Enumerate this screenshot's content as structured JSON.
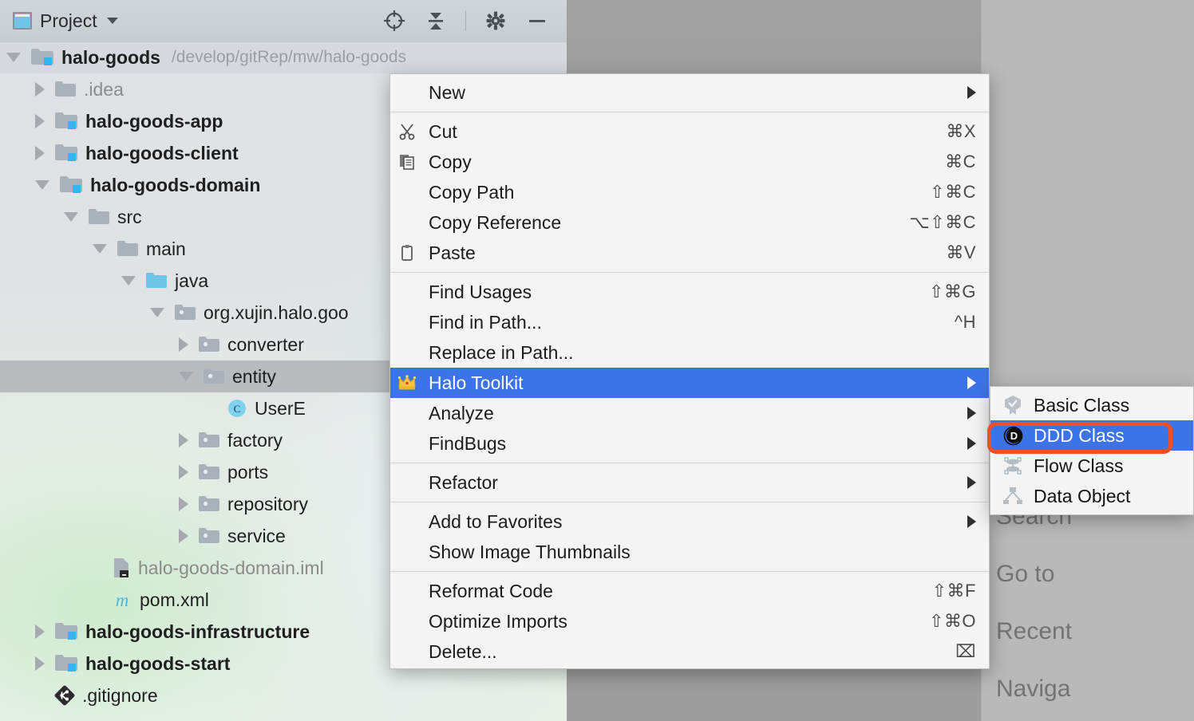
{
  "toolwindow": {
    "title": "Project",
    "icon": "project-icon",
    "caret": "chevron-down-icon",
    "actions": [
      {
        "name": "select-opened-file-icon",
        "label": "Select Opened File"
      },
      {
        "name": "collapse-all-icon",
        "label": "Collapse All"
      },
      {
        "name": "gear-icon",
        "label": "Settings"
      },
      {
        "name": "minimize-icon",
        "label": "Hide"
      }
    ]
  },
  "tree": {
    "rows": [
      {
        "label": "halo-goods",
        "path": "/develop/gitRep/mw/halo-goods",
        "depth": 0,
        "arrow": "open",
        "icon": "module-folder",
        "bold": true,
        "selected": "top"
      },
      {
        "label": ".idea",
        "path": "",
        "depth": 1,
        "arrow": "closed",
        "icon": "folder-gray",
        "bold": false,
        "muted": true
      },
      {
        "label": "halo-goods-app",
        "path": "",
        "depth": 1,
        "arrow": "closed",
        "icon": "module-folder",
        "bold": true
      },
      {
        "label": "halo-goods-client",
        "path": "",
        "depth": 1,
        "arrow": "closed",
        "icon": "module-folder",
        "bold": true
      },
      {
        "label": "halo-goods-domain",
        "path": "",
        "depth": 1,
        "arrow": "open",
        "icon": "module-folder",
        "bold": true
      },
      {
        "label": "src",
        "path": "",
        "depth": 2,
        "arrow": "open",
        "icon": "folder-gray",
        "bold": false
      },
      {
        "label": "main",
        "path": "",
        "depth": 3,
        "arrow": "open",
        "icon": "folder-gray",
        "bold": false
      },
      {
        "label": "java",
        "path": "",
        "depth": 4,
        "arrow": "open",
        "icon": "folder-source",
        "bold": false
      },
      {
        "label": "org.xujin.halo.goo",
        "path": "",
        "depth": 5,
        "arrow": "open",
        "icon": "package",
        "bold": false
      },
      {
        "label": "converter",
        "path": "",
        "depth": 6,
        "arrow": "closed",
        "icon": "package",
        "bold": false
      },
      {
        "label": "entity",
        "path": "",
        "depth": 6,
        "arrow": "open",
        "icon": "package",
        "bold": false,
        "selected": "yes"
      },
      {
        "label": "UserE",
        "path": "",
        "depth": 7,
        "arrow": "none",
        "icon": "class",
        "bold": false
      },
      {
        "label": "factory",
        "path": "",
        "depth": 6,
        "arrow": "closed",
        "icon": "package",
        "bold": false
      },
      {
        "label": "ports",
        "path": "",
        "depth": 6,
        "arrow": "closed",
        "icon": "package",
        "bold": false
      },
      {
        "label": "repository",
        "path": "",
        "depth": 6,
        "arrow": "closed",
        "icon": "package",
        "bold": false
      },
      {
        "label": "service",
        "path": "",
        "depth": 6,
        "arrow": "closed",
        "icon": "package",
        "bold": false
      },
      {
        "label": "halo-goods-domain.iml",
        "path": "",
        "depth": 3,
        "arrow": "none",
        "icon": "iml-file",
        "bold": false,
        "muted": true
      },
      {
        "label": "pom.xml",
        "path": "",
        "depth": 3,
        "arrow": "none",
        "icon": "maven-file",
        "bold": false
      },
      {
        "label": "halo-goods-infrastructure",
        "path": "",
        "depth": 1,
        "arrow": "closed",
        "icon": "module-folder",
        "bold": true
      },
      {
        "label": "halo-goods-start",
        "path": "",
        "depth": 1,
        "arrow": "closed",
        "icon": "module-folder",
        "bold": true
      },
      {
        "label": ".gitignore",
        "path": "",
        "depth": 1,
        "arrow": "none",
        "icon": "git-file",
        "bold": false
      }
    ]
  },
  "context_menu": {
    "groups": [
      {
        "items": [
          {
            "label": "New",
            "shortcut": "",
            "submenu": true,
            "icon": ""
          }
        ]
      },
      {
        "items": [
          {
            "label": "Cut",
            "shortcut": "⌘X",
            "submenu": false,
            "icon": "scissors-icon"
          },
          {
            "label": "Copy",
            "shortcut": "⌘C",
            "submenu": false,
            "icon": "copy-icon"
          },
          {
            "label": "Copy Path",
            "shortcut": "⇧⌘C",
            "submenu": false,
            "icon": ""
          },
          {
            "label": "Copy Reference",
            "shortcut": "⌥⇧⌘C",
            "submenu": false,
            "icon": ""
          },
          {
            "label": "Paste",
            "shortcut": "⌘V",
            "submenu": false,
            "icon": "clipboard-icon"
          }
        ]
      },
      {
        "items": [
          {
            "label": "Find Usages",
            "shortcut": "⇧⌘G",
            "submenu": false,
            "icon": ""
          },
          {
            "label": "Find in Path...",
            "shortcut": "^H",
            "submenu": false,
            "icon": ""
          },
          {
            "label": "Replace in Path...",
            "shortcut": "",
            "submenu": false,
            "icon": ""
          },
          {
            "label": "Halo Toolkit",
            "shortcut": "",
            "submenu": true,
            "icon": "crown-icon",
            "highlighted": true
          },
          {
            "label": "Analyze",
            "shortcut": "",
            "submenu": true,
            "icon": ""
          },
          {
            "label": "FindBugs",
            "shortcut": "",
            "submenu": true,
            "icon": ""
          }
        ]
      },
      {
        "items": [
          {
            "label": "Refactor",
            "shortcut": "",
            "submenu": true,
            "icon": ""
          }
        ]
      },
      {
        "items": [
          {
            "label": "Add to Favorites",
            "shortcut": "",
            "submenu": true,
            "icon": ""
          },
          {
            "label": "Show Image Thumbnails",
            "shortcut": "",
            "submenu": false,
            "icon": ""
          }
        ]
      },
      {
        "items": [
          {
            "label": "Reformat Code",
            "shortcut": "⇧⌘F",
            "submenu": false,
            "icon": ""
          },
          {
            "label": "Optimize Imports",
            "shortcut": "⇧⌘O",
            "submenu": false,
            "icon": ""
          },
          {
            "label": "Delete...",
            "shortcut": "⌧",
            "submenu": false,
            "icon": ""
          }
        ]
      }
    ]
  },
  "submenu": {
    "items": [
      {
        "label": "Basic Class",
        "icon": "basic-class-icon",
        "highlighted": false
      },
      {
        "label": "DDD Class",
        "icon": "ddd-class-icon",
        "highlighted": true
      },
      {
        "label": "Flow Class",
        "icon": "flow-class-icon",
        "highlighted": false
      },
      {
        "label": "Data Object",
        "icon": "data-object-icon",
        "highlighted": false
      }
    ]
  },
  "background_popup": {
    "rows": [
      "Search",
      "Go to",
      "Recent",
      "Naviga"
    ]
  },
  "colors": {
    "menu_highlight": "#3c74e8",
    "annotation": "#f04e23",
    "module_badge": "#2fb8ef",
    "source_folder": "#6fc5e8"
  }
}
